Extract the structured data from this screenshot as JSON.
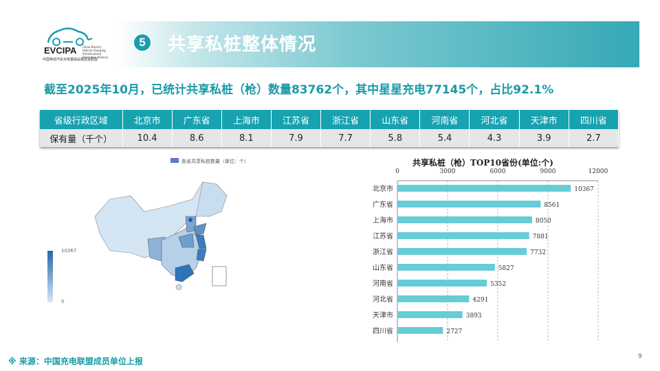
{
  "logo": {
    "brand": "EVCIPA",
    "subtitle": "中国电动汽车充电基础设施促进联盟",
    "english": "China Electric Vehicle Charging Infrastructure Promotion Alliance"
  },
  "header": {
    "number": "5",
    "title": "共享私桩整体情况"
  },
  "summary": "截至2025年10月，已统计共享私桩（枪）数量83762个，其中星星充电77145个，占比92.1%",
  "table": {
    "header_label": "省级行政区域",
    "row_label": "保有量（千个）",
    "regions": [
      "北京市",
      "广东省",
      "上海市",
      "江苏省",
      "浙江省",
      "山东省",
      "河南省",
      "河北省",
      "天津市",
      "四川省"
    ],
    "values": [
      "10.4",
      "8.6",
      "8.1",
      "7.9",
      "7.7",
      "5.8",
      "5.4",
      "4.3",
      "3.9",
      "2.7"
    ]
  },
  "map": {
    "legend": "各省共享私桩数量（单位：个）",
    "scale_max": "10367",
    "scale_min": "0",
    "colors": {
      "low": "#d6e6f5",
      "high": "#2566a8"
    }
  },
  "chart_data": {
    "type": "bar",
    "orientation": "horizontal",
    "title": "共享私桩（枪）TOP10省份(单位:个)",
    "categories": [
      "北京市",
      "广东省",
      "上海市",
      "江苏省",
      "浙江省",
      "山东省",
      "河南省",
      "河北省",
      "天津市",
      "四川省"
    ],
    "values": [
      10367,
      8561,
      8050,
      7881,
      7732,
      5827,
      5352,
      4291,
      3893,
      2727
    ],
    "xlim": [
      0,
      12000
    ],
    "xticks": [
      "0",
      "3000",
      "6000",
      "9000",
      "12000"
    ],
    "bar_color": "#66ccd6",
    "grid": true
  },
  "footer": {
    "source": "※  来源：中国充电联盟成员单位上报",
    "page": "9"
  }
}
